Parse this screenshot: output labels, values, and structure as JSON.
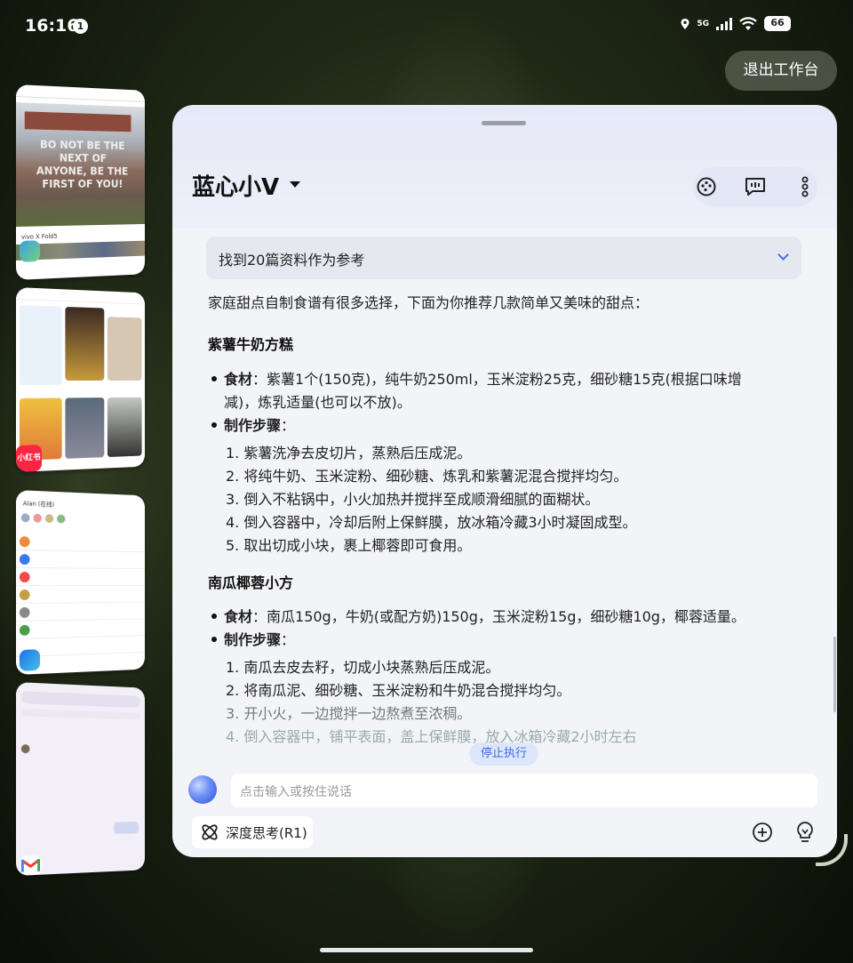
{
  "status_bar": {
    "time": "16:16",
    "notification_count": "1",
    "network": "5G",
    "battery": "66"
  },
  "workspace": {
    "exit_label": "退出工作台"
  },
  "thumbnails": [
    {
      "app": "photos",
      "caption": "vivo X Fold5",
      "sign_text": "BO NOT BE THE NEXT OF ANYONE, BE THE FIRST OF YOU!"
    },
    {
      "app": "xiaohongshu",
      "badge_label": "小红书"
    },
    {
      "app": "messaging",
      "header": "Alan (在线)"
    },
    {
      "app": "gmail"
    }
  ],
  "assistant": {
    "title": "蓝心小V",
    "references_label": "找到20篇资料作为参考",
    "intro": "家庭甜点自制食谱有很多选择，下面为你推荐几款简单又美味的甜点：",
    "recipes": [
      {
        "name": "紫薯牛奶方糕",
        "ingredients_label": "食材",
        "ingredients_line1": "：紫薯1个(150克)，纯牛奶250ml，玉米淀粉25克，细砂糖15克(根据口味增",
        "ingredients_line2": "减)，炼乳适量(也可以不放)。",
        "steps_label": "制作步骤",
        "steps_suffix": "：",
        "steps": [
          "1.  紫薯洗净去皮切片，蒸熟后压成泥。",
          "2.  将纯牛奶、玉米淀粉、细砂糖、炼乳和紫薯泥混合搅拌均匀。",
          "3.  倒入不粘锅中，小火加热并搅拌至成顺滑细腻的面糊状。",
          "4.  倒入容器中，冷却后附上保鲜膜，放冰箱冷藏3小时凝固成型。",
          "5.  取出切成小块，裹上椰蓉即可食用。"
        ]
      },
      {
        "name": "南瓜椰蓉小方",
        "ingredients_label": "食材",
        "ingredients_line1": "：南瓜150g，牛奶(或配方奶)150g，玉米淀粉15g，细砂糖10g，椰蓉适量。",
        "steps_label": "制作步骤",
        "steps_suffix": "：",
        "steps": [
          "1.  南瓜去皮去籽，切成小块蒸熟后压成泥。",
          "2.  将南瓜泥、细砂糖、玉米淀粉和牛奶混合搅拌均匀。",
          "3.  开小火，一边搅拌一边熬煮至浓稠。",
          "4.  倒入容器中，铺平表面，盖上保鲜膜，放入冰箱冷藏2小时左右"
        ]
      }
    ],
    "stop_label": "停止执行",
    "input_placeholder": "点击输入或按住说话",
    "deep_think_label": "深度思考(R1)"
  },
  "colors": {
    "accent": "#3d6ae6",
    "panel_bg": "#f3f4f8"
  }
}
